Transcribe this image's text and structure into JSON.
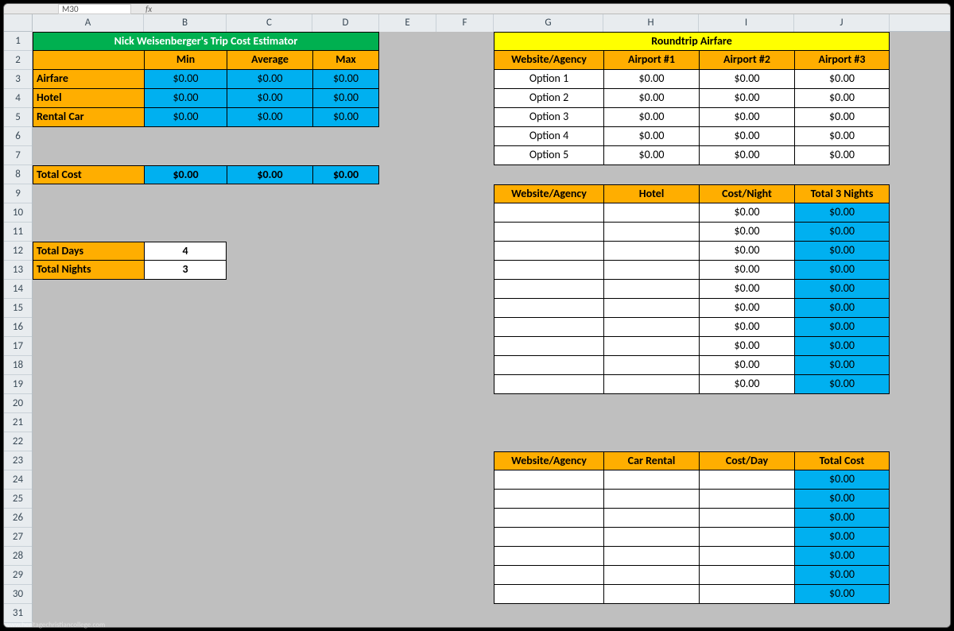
{
  "formula": {
    "cellref": "M30",
    "fx": "fx"
  },
  "cols": [
    "A",
    "B",
    "C",
    "D",
    "E",
    "F",
    "G",
    "H",
    "I",
    "J"
  ],
  "rows": [
    "1",
    "2",
    "3",
    "4",
    "5",
    "6",
    "7",
    "8",
    "9",
    "10",
    "11",
    "12",
    "13",
    "14",
    "15",
    "16",
    "17",
    "18",
    "19",
    "20",
    "21",
    "22",
    "23",
    "24",
    "25",
    "26",
    "27",
    "28",
    "29",
    "30",
    "31"
  ],
  "trip": {
    "title": "Nick Weisenberger's Trip Cost Estimator",
    "hdr_min": "Min",
    "hdr_avg": "Average",
    "hdr_max": "Max",
    "airfare_lbl": "Airfare",
    "hotel_lbl": "Hotel",
    "rental_lbl": "Rental Car",
    "airfare": {
      "min": "$0.00",
      "avg": "$0.00",
      "max": "$0.00"
    },
    "hotel": {
      "min": "$0.00",
      "avg": "$0.00",
      "max": "$0.00"
    },
    "rental": {
      "min": "$0.00",
      "avg": "$0.00",
      "max": "$0.00"
    },
    "total_lbl": "Total Cost",
    "total": {
      "min": "$0.00",
      "avg": "$0.00",
      "max": "$0.00"
    },
    "days_lbl": "Total Days",
    "days_val": "4",
    "nights_lbl": "Total Nights",
    "nights_val": "3"
  },
  "airfare_tbl": {
    "title": "Roundtrip Airfare",
    "hdr_agency": "Website/Agency",
    "hdr_a1": "Airport #1",
    "hdr_a2": "Airport #2",
    "hdr_a3": "Airport #3",
    "r1": {
      "name": "Option 1",
      "a1": "$0.00",
      "a2": "$0.00",
      "a3": "$0.00"
    },
    "r2": {
      "name": "Option 2",
      "a1": "$0.00",
      "a2": "$0.00",
      "a3": "$0.00"
    },
    "r3": {
      "name": "Option 3",
      "a1": "$0.00",
      "a2": "$0.00",
      "a3": "$0.00"
    },
    "r4": {
      "name": "Option 4",
      "a1": "$0.00",
      "a2": "$0.00",
      "a3": "$0.00"
    },
    "r5": {
      "name": "Option 5",
      "a1": "$0.00",
      "a2": "$0.00",
      "a3": "$0.00"
    }
  },
  "hotel_tbl": {
    "hdr_agency": "Website/Agency",
    "hdr_hotel": "Hotel",
    "hdr_cost": "Cost/Night",
    "hdr_total": "Total 3 Nights",
    "r1": {
      "cost": "$0.00",
      "total": "$0.00"
    },
    "r2": {
      "cost": "$0.00",
      "total": "$0.00"
    },
    "r3": {
      "cost": "$0.00",
      "total": "$0.00"
    },
    "r4": {
      "cost": "$0.00",
      "total": "$0.00"
    },
    "r5": {
      "cost": "$0.00",
      "total": "$0.00"
    },
    "r6": {
      "cost": "$0.00",
      "total": "$0.00"
    },
    "r7": {
      "cost": "$0.00",
      "total": "$0.00"
    },
    "r8": {
      "cost": "$0.00",
      "total": "$0.00"
    },
    "r9": {
      "cost": "$0.00",
      "total": "$0.00"
    },
    "r10": {
      "cost": "$0.00",
      "total": "$0.00"
    }
  },
  "car_tbl": {
    "hdr_agency": "Website/Agency",
    "hdr_car": "Car Rental",
    "hdr_cost": "Cost/Day",
    "hdr_total": "Total Cost",
    "r1": {
      "total": "$0.00"
    },
    "r2": {
      "total": "$0.00"
    },
    "r3": {
      "total": "$0.00"
    },
    "r4": {
      "total": "$0.00"
    },
    "r5": {
      "total": "$0.00"
    },
    "r6": {
      "total": "$0.00"
    },
    "r7": {
      "total": "$0.00"
    }
  },
  "watermark": "www.heritagechristiancollege.com"
}
